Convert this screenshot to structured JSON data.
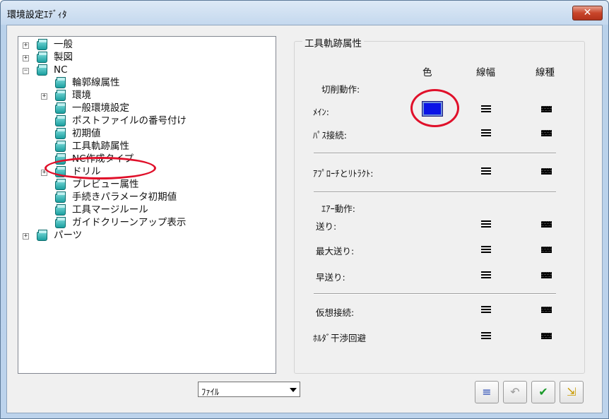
{
  "window": {
    "title": "環境設定ｴﾃﾞｨﾀ",
    "close_label": "✕"
  },
  "tree": {
    "items": [
      {
        "label": "一般",
        "expander": "+"
      },
      {
        "label": "製図",
        "expander": "+"
      },
      {
        "label": "NC",
        "expander": "−"
      },
      {
        "label": "輪郭線属性",
        "expander": ""
      },
      {
        "label": "環境",
        "expander": "+"
      },
      {
        "label": "一般環境設定",
        "expander": ""
      },
      {
        "label": "ポストファイルの番号付け",
        "expander": ""
      },
      {
        "label": "初期値",
        "expander": ""
      },
      {
        "label": "工具軌跡属性",
        "expander": ""
      },
      {
        "label": "NC作成タイプ",
        "expander": ""
      },
      {
        "label": "ドリル",
        "expander": "+"
      },
      {
        "label": "プレビュー属性",
        "expander": ""
      },
      {
        "label": "手続きパラメータ初期値",
        "expander": ""
      },
      {
        "label": "工具マージルール",
        "expander": ""
      },
      {
        "label": "ガイドクリーンアップ表示",
        "expander": ""
      },
      {
        "label": "パーツ",
        "expander": "+"
      }
    ],
    "selected": "工具軌跡属性"
  },
  "file_dropdown": {
    "value": "ﾌｧｲﾙ"
  },
  "panel": {
    "title": "工具軌跡属性",
    "headers": {
      "color": "色",
      "width": "線幅",
      "type": "線種"
    },
    "sections": {
      "cutting": "切削動作:",
      "air": "ｴｱｰ動作:"
    },
    "rows": {
      "main": "ﾒｲﾝ:",
      "pass_connect": "ﾊﾟｽ接続:",
      "approach_retract": "ｱﾌﾟﾛｰﾁとﾘﾄﾗｸﾄ:",
      "feed": "送り:",
      "max_feed": "最大送り:",
      "rapid": "早送り:",
      "virtual_connect": "仮想接続:",
      "holder_avoid": "ﾎﾙﾀﾞ干渉回避"
    },
    "main_color": "#0b14e6"
  },
  "toolbar": {
    "list_icon": "≡",
    "undo_icon": "↶",
    "ok_icon": "✔",
    "apply_icon": "⇲"
  }
}
